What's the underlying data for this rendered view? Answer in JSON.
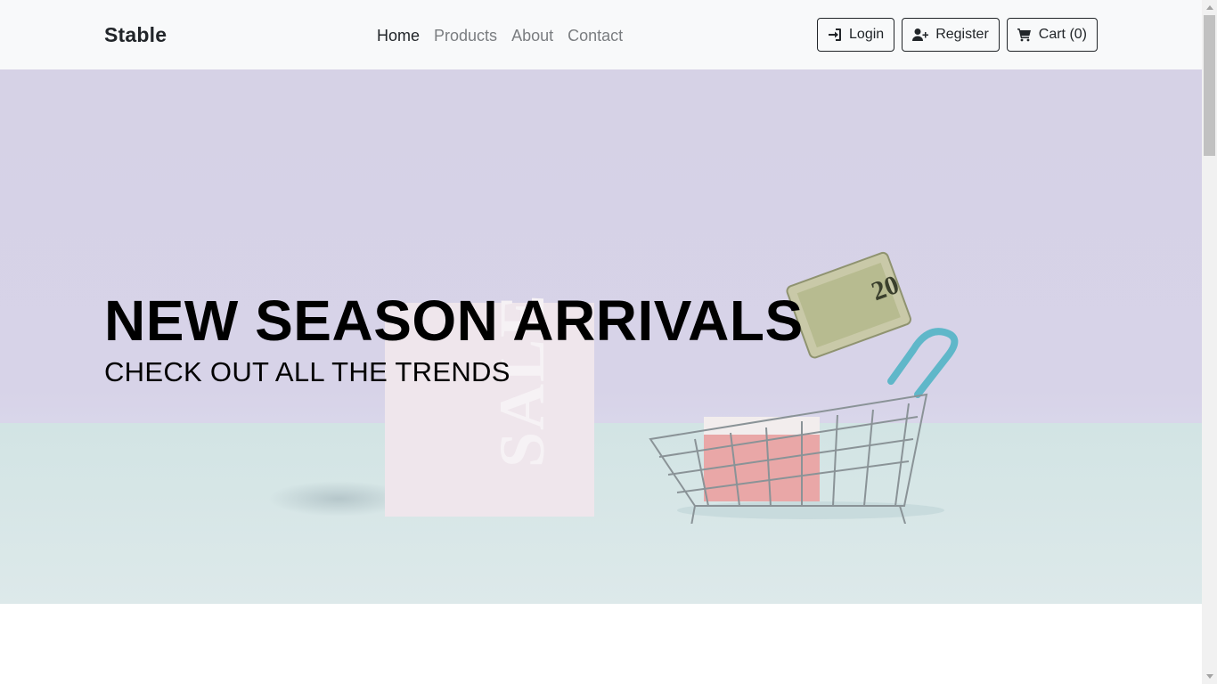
{
  "navbar": {
    "brand": "Stable",
    "links": [
      {
        "label": "Home",
        "active": true
      },
      {
        "label": "Products",
        "active": false
      },
      {
        "label": "About",
        "active": false
      },
      {
        "label": "Contact",
        "active": false
      }
    ],
    "buttons": {
      "login": {
        "label": "Login",
        "icon": "sign-in-icon"
      },
      "register": {
        "label": "Register",
        "icon": "user-plus-icon"
      },
      "cart": {
        "label": "Cart (0)",
        "icon": "cart-icon"
      }
    }
  },
  "hero": {
    "title": "NEW SEASON ARRIVALS",
    "subtitle": "CHECK OUT ALL THE TRENDS",
    "image": {
      "card_text": "SALE",
      "banknote_text": "20"
    }
  },
  "colors": {
    "navbar_bg": "#f8f9fa",
    "text_dark": "#212529",
    "link_muted": "#7a7d80",
    "hero_wall": "#d6d2e6",
    "hero_floor": "#d2e4e4"
  }
}
